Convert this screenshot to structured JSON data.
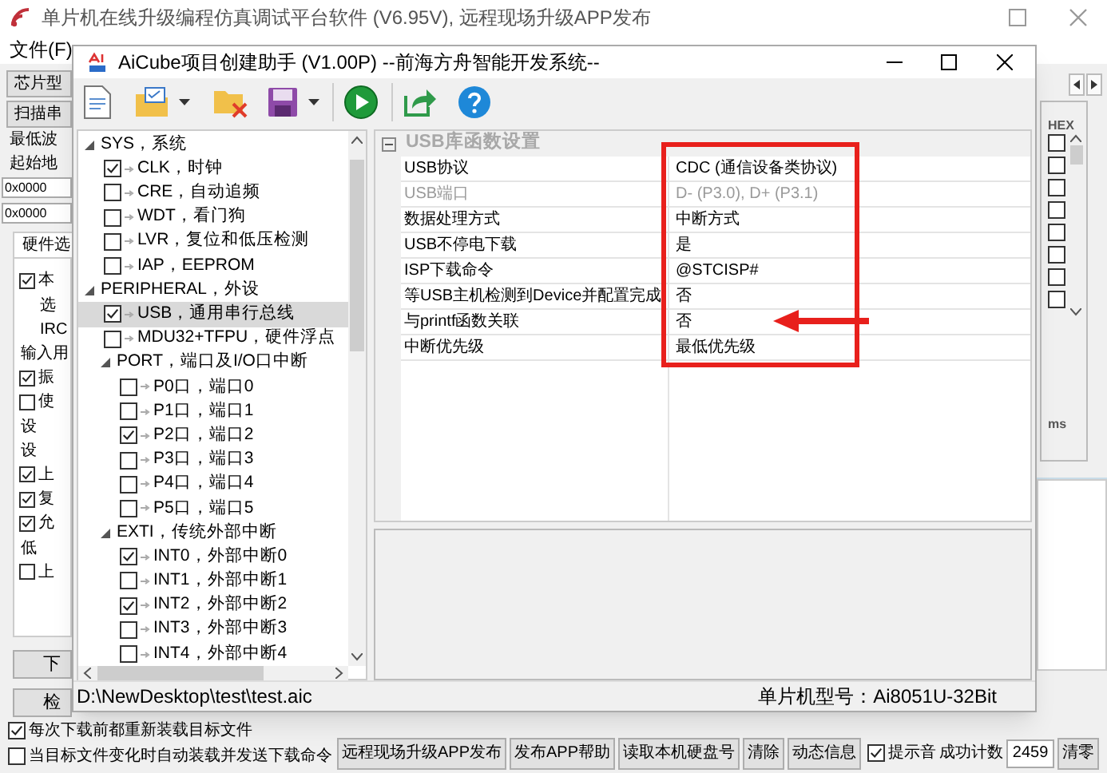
{
  "main_window": {
    "title": "单片机在线升级编程仿真调试平台软件 (V6.95V), 远程现场升级APP发布",
    "menu": [
      "文件(F)"
    ]
  },
  "left_panel": {
    "controls": [
      {
        "kind": "button",
        "label": "芯片型"
      },
      {
        "kind": "button",
        "label": "扫描串"
      },
      {
        "kind": "label",
        "label": "最低波"
      },
      {
        "kind": "label",
        "label": "起始地"
      },
      {
        "kind": "field",
        "value": "0x0000"
      },
      {
        "kind": "field",
        "value": "0x0000"
      },
      {
        "kind": "tab",
        "label": "硬件选",
        "selected": true
      }
    ],
    "options": [
      {
        "kind": "check",
        "label": "本",
        "checked": true
      },
      {
        "kind": "label",
        "label": "选"
      },
      {
        "kind": "label",
        "label": "IRC"
      },
      {
        "kind": "label",
        "label": "输入用"
      },
      {
        "kind": "check",
        "label": "振",
        "checked": true
      },
      {
        "kind": "check",
        "label": "使",
        "checked": false
      },
      {
        "kind": "label",
        "label": "设"
      },
      {
        "kind": "label",
        "label": "设"
      },
      {
        "kind": "check",
        "label": "上",
        "checked": true
      },
      {
        "kind": "check",
        "label": "复",
        "checked": true
      },
      {
        "kind": "check",
        "label": "允",
        "checked": true
      },
      {
        "kind": "label",
        "label": "低"
      },
      {
        "kind": "check",
        "label": "上",
        "checked": false
      }
    ],
    "buttons": [
      "下",
      "检"
    ]
  },
  "right_panel": {
    "hex_label": "HEX",
    "checkboxes": [
      {
        "checked": false
      },
      {
        "checked": false
      },
      {
        "checked": false
      },
      {
        "checked": false
      },
      {
        "checked": false
      },
      {
        "checked": false
      },
      {
        "checked": false
      },
      {
        "checked": false
      }
    ],
    "unit_label": "ms"
  },
  "dialog": {
    "title": "AiCube项目创建助手 (V1.00P) --前海方舟智能开发系统--",
    "tree": [
      {
        "kind": "group",
        "label": "SYS，系统",
        "expanded": true,
        "selected": false,
        "children": [
          {
            "kind": "leaf",
            "label": "CLK，时钟",
            "checked": true,
            "selected": false
          },
          {
            "kind": "leaf",
            "label": "CRE，自动追频",
            "checked": false,
            "selected": false
          },
          {
            "kind": "leaf",
            "label": "WDT，看门狗",
            "checked": false,
            "selected": false
          },
          {
            "kind": "leaf",
            "label": "LVR，复位和低压检测",
            "checked": false,
            "selected": false
          },
          {
            "kind": "leaf",
            "label": "IAP，EEPROM",
            "checked": false,
            "selected": false
          }
        ]
      },
      {
        "kind": "group",
        "label": "PERIPHERAL，外设",
        "expanded": true,
        "selected": false,
        "children": [
          {
            "kind": "leaf",
            "label": "USB，通用串行总线",
            "checked": true,
            "selected": true
          },
          {
            "kind": "leaf",
            "label": "MDU32+TFPU，硬件浮点",
            "checked": false,
            "selected": false
          },
          {
            "kind": "group",
            "label": "PORT，端口及I/O口中断",
            "expanded": true,
            "selected": false,
            "children": [
              {
                "kind": "leaf",
                "label": "P0口，端口0",
                "checked": false,
                "selected": false
              },
              {
                "kind": "leaf",
                "label": "P1口，端口1",
                "checked": false,
                "selected": false
              },
              {
                "kind": "leaf",
                "label": "P2口，端口2",
                "checked": true,
                "selected": false
              },
              {
                "kind": "leaf",
                "label": "P3口，端口3",
                "checked": false,
                "selected": false
              },
              {
                "kind": "leaf",
                "label": "P4口，端口4",
                "checked": false,
                "selected": false
              },
              {
                "kind": "leaf",
                "label": "P5口，端口5",
                "checked": false,
                "selected": false
              }
            ]
          },
          {
            "kind": "group",
            "label": "EXTI，传统外部中断",
            "expanded": true,
            "selected": false,
            "children": [
              {
                "kind": "leaf",
                "label": "INT0，外部中断0",
                "checked": true,
                "selected": false
              },
              {
                "kind": "leaf",
                "label": "INT1，外部中断1",
                "checked": false,
                "selected": false
              },
              {
                "kind": "leaf",
                "label": "INT2，外部中断2",
                "checked": true,
                "selected": false
              },
              {
                "kind": "leaf",
                "label": "INT3，外部中断3",
                "checked": false,
                "selected": false
              },
              {
                "kind": "leaf",
                "label": "INT4，外部中断4",
                "checked": false,
                "selected": false
              }
            ]
          }
        ]
      }
    ],
    "property_grid": {
      "category": "USB库函数设置",
      "expanded": true,
      "rows": [
        {
          "name": "USB协议",
          "value": "CDC (通信设备类协议)",
          "disabled": false
        },
        {
          "name": "USB端口",
          "value": "D- (P3.0), D+ (P3.1)",
          "disabled": true
        },
        {
          "name": "数据处理方式",
          "value": "中断方式",
          "disabled": false
        },
        {
          "name": "USB不停电下载",
          "value": "是",
          "disabled": false
        },
        {
          "name": "ISP下载命令",
          "value": "@STCISP#",
          "disabled": false
        },
        {
          "name": "等USB主机检测到Device并配置完成",
          "value": "否",
          "disabled": false
        },
        {
          "name": "与printf函数关联",
          "value": "否",
          "disabled": false
        },
        {
          "name": "中断优先级",
          "value": "最低优先级",
          "disabled": false
        }
      ]
    },
    "status_bar": {
      "path": "D:\\NewDesktop\\test\\test.aic",
      "chip_model": "单片机型号：Ai8051U-32Bit"
    }
  },
  "bottom_bar": {
    "options": [
      {
        "label": "每次下载前都重新装载目标文件",
        "checked": true
      },
      {
        "label": "当目标文件变化时自动装载并发送下载命令",
        "checked": false
      }
    ],
    "buttons": [
      "远程现场升级APP发布",
      "发布APP帮助",
      "读取本机硬盘号",
      "清除",
      "动态信息"
    ],
    "sound": {
      "label": "提示音",
      "checked": true
    },
    "count_label": "成功计数",
    "count": "2459",
    "reset_button": "清零"
  }
}
